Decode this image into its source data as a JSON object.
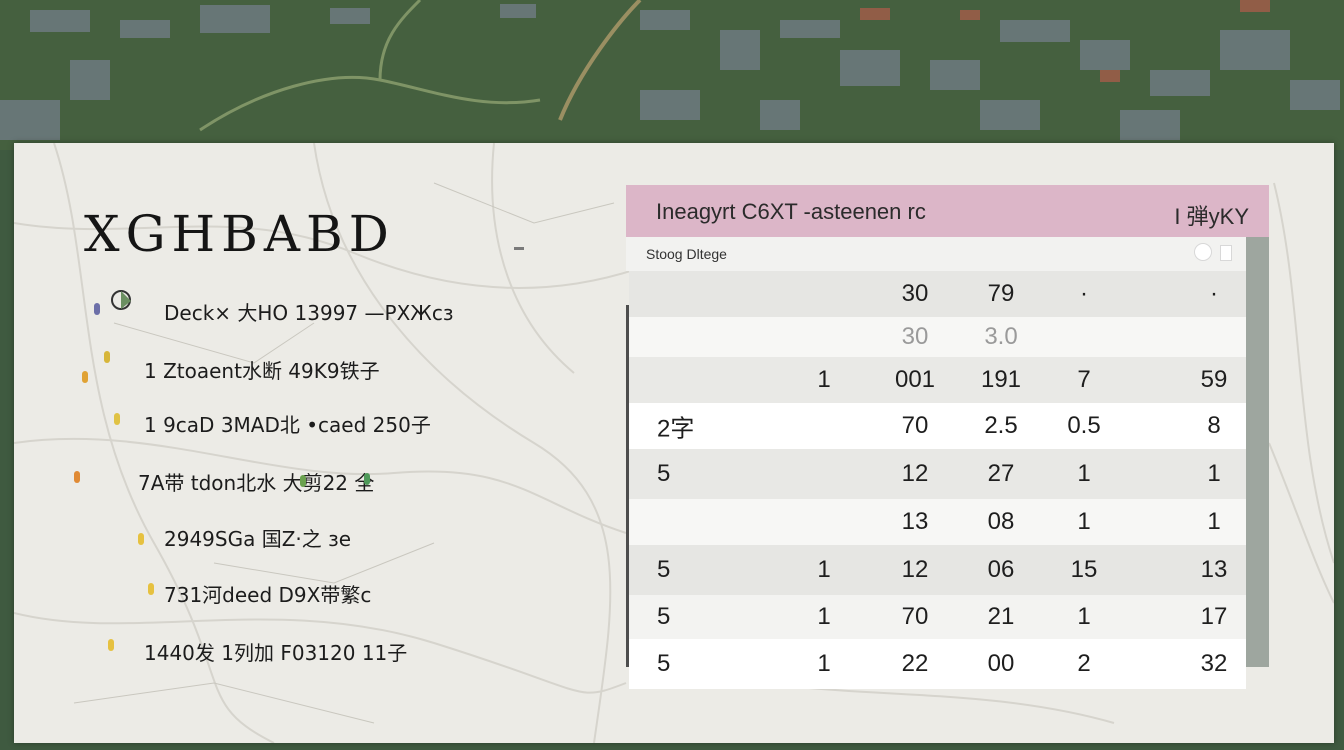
{
  "title": "XGHBABD",
  "legend": {
    "rows": [
      {
        "text": "Deck× 大HO  13997 —PХЖсз"
      },
      {
        "text": "1  Ztoaent水断  49K9铁子"
      },
      {
        "text": "1  9caD  3MAD北 •caed 250子"
      },
      {
        "text": "7A带  tdon北水  大剪22  全"
      },
      {
        "text": "2949SGа          国Z·之 зе"
      },
      {
        "text": "731河deed  D9X带繁с"
      },
      {
        "text": "1440发 1列加  F03120  11子"
      }
    ]
  },
  "table": {
    "header_title": "Ineagyrt  C6XT  -asteenen rc",
    "header_right": "I 弾yKY",
    "sub_label": "Stoog Dltege",
    "rows": [
      {
        "label": "",
        "c1": "",
        "c2": "30",
        "c3": "79",
        "c4": "·",
        "c5": "·",
        "faint": false
      },
      {
        "label": "",
        "c1": "",
        "c2": "30",
        "c3": "3.0",
        "c4": "",
        "c5": "",
        "faint": true
      },
      {
        "label": "",
        "c1": "1",
        "c2": "001",
        "c3": "191",
        "c4": "7",
        "c5": "59",
        "faint": false
      },
      {
        "label": "2字",
        "c1": "",
        "c2": "70",
        "c3": "2.5",
        "c4": "0.5",
        "c5": "8",
        "faint": false
      },
      {
        "label": "5",
        "c1": "",
        "c2": "12",
        "c3": "27",
        "c4": "1",
        "c5": "1",
        "faint": false
      },
      {
        "label": "",
        "c1": "",
        "c2": "13",
        "c3": "08",
        "c4": "1",
        "c5": "1",
        "faint": false
      },
      {
        "label": "5",
        "c1": "1",
        "c2": "12",
        "c3": "06",
        "c4": "15",
        "c5": "13",
        "faint": false
      },
      {
        "label": "5",
        "c1": "1",
        "c2": "70",
        "c3": "21",
        "c4": "1",
        "c5": "17",
        "faint": false
      },
      {
        "label": "5",
        "c1": "1",
        "c2": "22",
        "c3": "00",
        "c4": "2",
        "c5": "32",
        "faint": false
      }
    ]
  },
  "colors": {
    "header": "#dcb6c8",
    "panel": "#ecebe6",
    "aerial": "#3d5640"
  }
}
